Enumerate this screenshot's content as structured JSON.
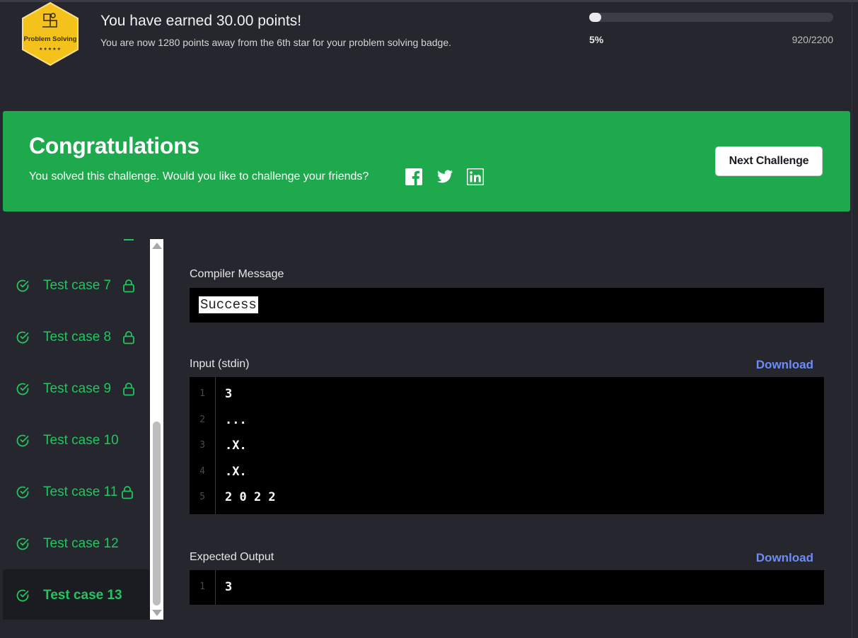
{
  "header": {
    "badge": {
      "name": "Problem Solving",
      "stars": "★★★★★"
    },
    "earned_title": "You have earned 30.00 points!",
    "earned_subtitle": "You are now 1280 points away from the 6th star for your problem solving badge.",
    "progress": {
      "fraction": 0.05,
      "percent_label": "5%",
      "count_label": "920/2200"
    }
  },
  "banner": {
    "title": "Congratulations",
    "subtitle": "You solved this challenge. Would you like to challenge your friends?",
    "social": [
      "facebook-icon",
      "twitter-icon",
      "linkedin-icon"
    ],
    "next_button": "Next Challenge"
  },
  "test_cases": [
    {
      "label": "Test case 7",
      "locked": true,
      "active": false
    },
    {
      "label": "Test case 8",
      "locked": true,
      "active": false
    },
    {
      "label": "Test case 9",
      "locked": true,
      "active": false
    },
    {
      "label": "Test case 10",
      "locked": false,
      "active": false
    },
    {
      "label": "Test case 11",
      "locked": true,
      "active": false
    },
    {
      "label": "Test case 12",
      "locked": false,
      "active": false
    },
    {
      "label": "Test case 13",
      "locked": false,
      "active": true
    }
  ],
  "compiler": {
    "label": "Compiler Message",
    "message": "Success"
  },
  "input": {
    "label": "Input (stdin)",
    "download": "Download",
    "lines": [
      {
        "n": "1",
        "text": "3"
      },
      {
        "n": "2",
        "text": "..."
      },
      {
        "n": "3",
        "text": ".X."
      },
      {
        "n": "4",
        "text": ".X."
      },
      {
        "n": "5",
        "text": "2 0 2 2"
      }
    ]
  },
  "expected": {
    "label": "Expected Output",
    "download": "Download",
    "lines": [
      {
        "n": "1",
        "text": "3"
      }
    ]
  },
  "colors": {
    "success_green": "#22c55e",
    "banner_green": "#1ea94c",
    "link_blue": "#6d8cf5",
    "badge_gold": "#f4c21b"
  }
}
